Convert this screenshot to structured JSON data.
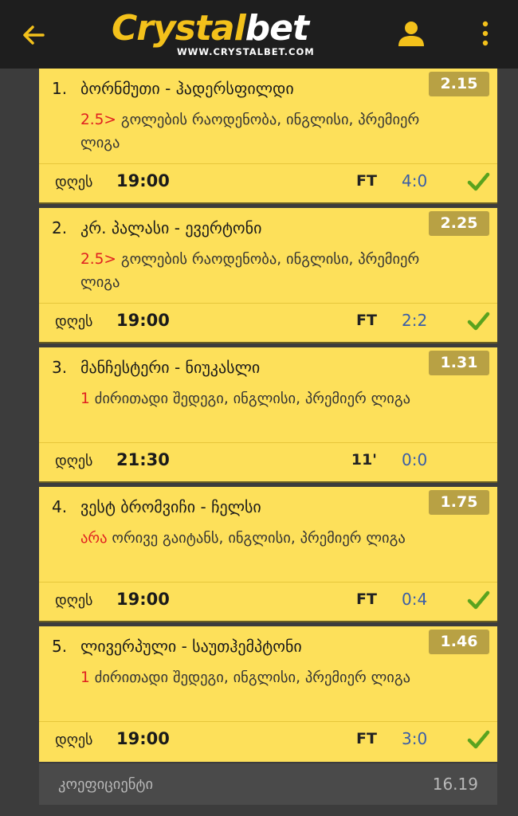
{
  "header": {
    "logo_main": "Crystal",
    "logo_accent": "bet",
    "logo_url": "WWW.CRYSTALBET.COM",
    "back_icon": "arrow-left-icon",
    "user_icon": "user-icon",
    "menu_icon": "more-vertical-icon",
    "accent_color": "#f3c11b"
  },
  "bets": [
    {
      "num": "1.",
      "match": "ბორნმუთი - ჰადერსფილდი",
      "odd": "2.15",
      "selection": "2.5>",
      "market": "გოლების რაოდენობა, ინგლისი, პრემიერ ლიგა",
      "day": "დღეს",
      "time": "19:00",
      "status": "FT",
      "score": "4:0",
      "won": true
    },
    {
      "num": "2.",
      "match": "კრ. პალასი - ევერტონი",
      "odd": "2.25",
      "selection": "2.5>",
      "market": "გოლების რაოდენობა, ინგლისი, პრემიერ ლიგა",
      "day": "დღეს",
      "time": "19:00",
      "status": "FT",
      "score": "2:2",
      "won": true
    },
    {
      "num": "3.",
      "match": "მანჩესტერი - ნიუკასლი",
      "odd": "1.31",
      "selection": "1",
      "market": "ძირითადი შედეგი, ინგლისი, პრემიერ ლიგა",
      "day": "დღეს",
      "time": "21:30",
      "status": "11'",
      "score": "0:0",
      "won": false
    },
    {
      "num": "4.",
      "match": "ვესტ ბრომვიჩი - ჩელსი",
      "odd": "1.75",
      "selection": "არა",
      "market": "ორივე გაიტანს, ინგლისი, პრემიერ ლიგა",
      "day": "დღეს",
      "time": "19:00",
      "status": "FT",
      "score": "0:4",
      "won": true
    },
    {
      "num": "5.",
      "match": "ლივერპული - საუთჰემპტონი",
      "odd": "1.46",
      "selection": "1",
      "market": "ძირითადი შედეგი, ინგლისი, პრემიერ ლიგა",
      "day": "დღეს",
      "time": "19:00",
      "status": "FT",
      "score": "3:0",
      "won": true
    }
  ],
  "footer": {
    "coef_label": "კოეფიციენტი",
    "coef_value": "16.19"
  },
  "colors": {
    "card_bg": "#fde05a",
    "odd_badge": "#b8a144",
    "selection_red": "#e02020",
    "score_blue": "#3a5ea8",
    "check_green": "#5aa31e"
  }
}
